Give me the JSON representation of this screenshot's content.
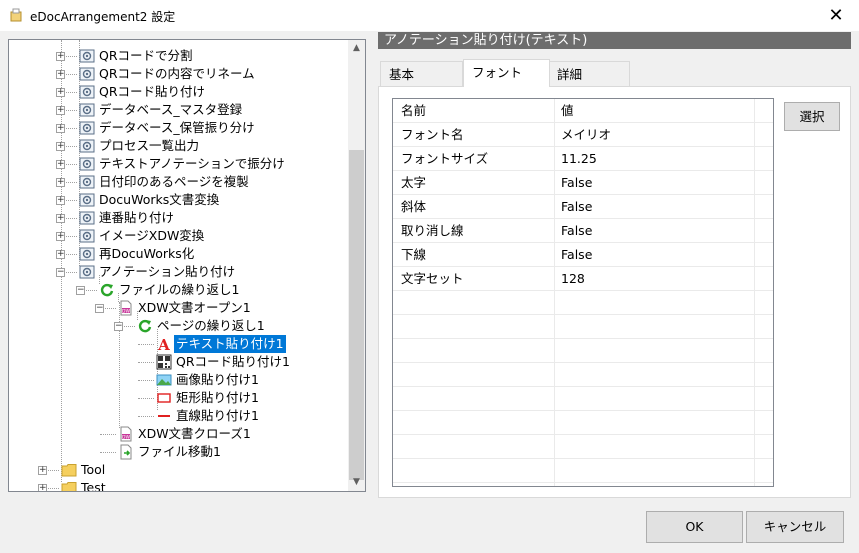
{
  "window": {
    "title": "eDocArrangement2 設定",
    "close_glyph": "✕"
  },
  "tree": {
    "items": [
      {
        "label": "QRコードで分割",
        "icon": "settings-node-icon"
      },
      {
        "label": "QRコードの内容でリネーム",
        "icon": "settings-node-icon"
      },
      {
        "label": "QRコード貼り付け",
        "icon": "settings-node-icon"
      },
      {
        "label": "データベース_マスタ登録",
        "icon": "settings-node-icon"
      },
      {
        "label": "データベース_保管振り分け",
        "icon": "settings-node-icon"
      },
      {
        "label": "プロセス一覧出力",
        "icon": "settings-node-icon"
      },
      {
        "label": "テキストアノテーションで振分け",
        "icon": "settings-node-icon"
      },
      {
        "label": "日付印のあるページを複製",
        "icon": "settings-node-icon"
      },
      {
        "label": "DocuWorks文書変換",
        "icon": "settings-node-icon"
      },
      {
        "label": "連番貼り付け",
        "icon": "settings-node-icon"
      },
      {
        "label": "イメージXDW変換",
        "icon": "settings-node-icon"
      },
      {
        "label": "再DocuWorks化",
        "icon": "settings-node-icon"
      },
      {
        "label": "アノテーション貼り付け",
        "icon": "settings-node-icon"
      },
      {
        "label": "ファイルの繰り返し1",
        "icon": "loop-icon"
      },
      {
        "label": "XDW文書オープン1",
        "icon": "xdw-document-icon"
      },
      {
        "label": "ページの繰り返し1",
        "icon": "loop-icon"
      },
      {
        "label": "テキスト貼り付け1",
        "icon": "text-annotation-icon"
      },
      {
        "label": "QRコード貼り付け1",
        "icon": "qr-code-icon"
      },
      {
        "label": "画像貼り付け1",
        "icon": "image-icon"
      },
      {
        "label": "矩形貼り付け1",
        "icon": "rectangle-icon"
      },
      {
        "label": "直線貼り付け1",
        "icon": "line-icon"
      },
      {
        "label": "XDW文書クローズ1",
        "icon": "xdw-document-icon"
      },
      {
        "label": "ファイル移動1",
        "icon": "file-move-icon"
      },
      {
        "label": "Tool",
        "icon": "folder-icon"
      },
      {
        "label": "Test",
        "icon": "folder-icon"
      }
    ],
    "expand_glyph": "+",
    "collapse_glyph": "−",
    "scroll_up_glyph": "▲",
    "scroll_down_glyph": "▼"
  },
  "panel": {
    "header": "アノテーション貼り付け(テキスト)",
    "tabs": [
      "基本",
      "フォント",
      "詳細"
    ],
    "active_tab": "フォント"
  },
  "grid": {
    "headers": [
      "名前",
      "値"
    ],
    "rows": [
      [
        "フォント名",
        "メイリオ"
      ],
      [
        "フォントサイズ",
        "11.25"
      ],
      [
        "太字",
        "False"
      ],
      [
        "斜体",
        "False"
      ],
      [
        "取り消し線",
        "False"
      ],
      [
        "下線",
        "False"
      ],
      [
        "文字セット",
        "128"
      ]
    ]
  },
  "buttons": {
    "select": "選択",
    "ok": "OK",
    "cancel": "キャンセル"
  },
  "colors": {
    "selection": "#0078d7",
    "header_bar": "#6d6d6d",
    "loop_green": "#2aa52a",
    "text_annotation_red": "#e02020"
  }
}
